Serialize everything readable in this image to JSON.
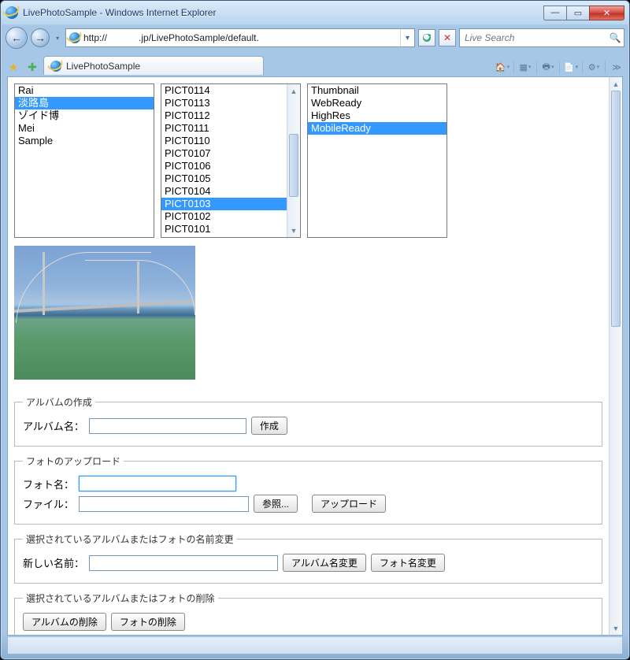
{
  "window": {
    "title": "LivePhotoSample - Windows Internet Explorer"
  },
  "nav": {
    "url": "http://            .jp/LivePhotoSample/default."
  },
  "search": {
    "placeholder": "Live Search"
  },
  "tab": {
    "title": "LivePhotoSample"
  },
  "albums": {
    "items": [
      "Rai",
      "淡路島",
      "ゾイド博",
      "Mei",
      "Sample"
    ],
    "selectedIndex": 1
  },
  "photos": {
    "items": [
      "PICT0114",
      "PICT0113",
      "PICT0112",
      "PICT0111",
      "PICT0110",
      "PICT0107",
      "PICT0106",
      "PICT0105",
      "PICT0104",
      "PICT0103",
      "PICT0102",
      "PICT0101"
    ],
    "selectedIndex": 9
  },
  "sizes": {
    "items": [
      "Thumbnail",
      "WebReady",
      "HighRes",
      "MobileReady"
    ],
    "selectedIndex": 3
  },
  "sections": {
    "create": {
      "legend": "アルバムの作成",
      "albumNameLabel": "アルバム名：",
      "createBtn": "作成"
    },
    "upload": {
      "legend": "フォトのアップロード",
      "photoNameLabel": "フォト名：",
      "fileLabel": "ファイル：",
      "browseBtn": "参照...",
      "uploadBtn": "アップロード"
    },
    "rename": {
      "legend": "選択されているアルバムまたはフォトの名前変更",
      "newNameLabel": "新しい名前：",
      "renameAlbumBtn": "アルバム名変更",
      "renamePhotoBtn": "フォト名変更"
    },
    "delete": {
      "legend": "選択されているアルバムまたはフォトの削除",
      "deleteAlbumBtn": "アルバムの削除",
      "deletePhotoBtn": "フォトの削除"
    }
  }
}
